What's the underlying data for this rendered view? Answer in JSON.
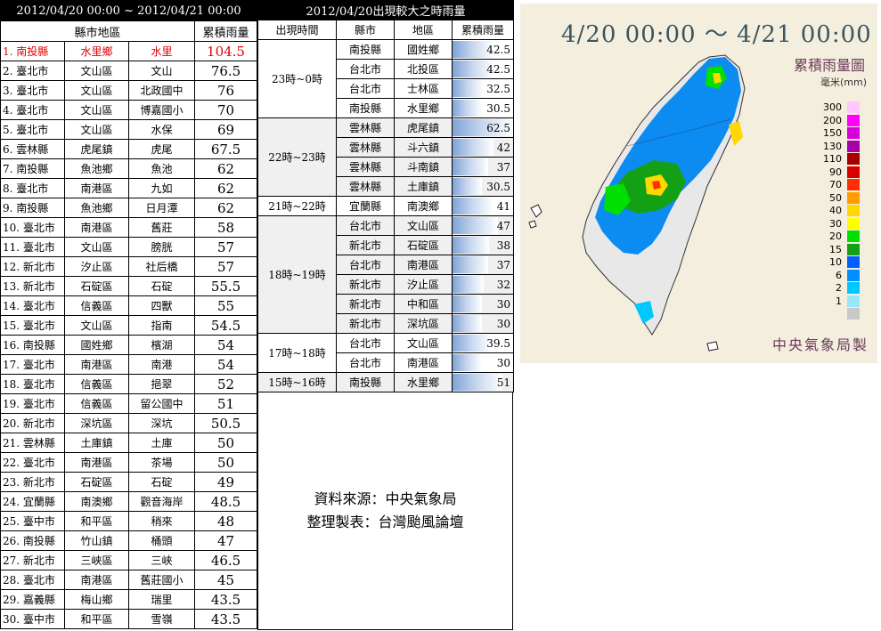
{
  "left": {
    "title": "2012/04/20 00:00 ~ 2012/04/21 00:00",
    "col_region": "縣市地區",
    "col_amount": "累積雨量",
    "rows": [
      {
        "rank": "1. 南投縣",
        "town": "水里鄉",
        "station": "水里",
        "value": "104.5"
      },
      {
        "rank": "2. 臺北市",
        "town": "文山區",
        "station": "文山",
        "value": "76.5"
      },
      {
        "rank": "3. 臺北市",
        "town": "文山區",
        "station": "北政國中",
        "value": "76"
      },
      {
        "rank": "4. 臺北市",
        "town": "文山區",
        "station": "博嘉國小",
        "value": "70"
      },
      {
        "rank": "5. 臺北市",
        "town": "文山區",
        "station": "水保",
        "value": "69"
      },
      {
        "rank": "6. 雲林縣",
        "town": "虎尾鎮",
        "station": "虎尾",
        "value": "67.5"
      },
      {
        "rank": "7. 南投縣",
        "town": "魚池鄉",
        "station": "魚池",
        "value": "62"
      },
      {
        "rank": "8. 臺北市",
        "town": "南港區",
        "station": "九如",
        "value": "62"
      },
      {
        "rank": "9. 南投縣",
        "town": "魚池鄉",
        "station": "日月潭",
        "value": "62"
      },
      {
        "rank": "10. 臺北市",
        "town": "南港區",
        "station": "舊莊",
        "value": "58"
      },
      {
        "rank": "11. 臺北市",
        "town": "文山區",
        "station": "膀胱",
        "value": "57"
      },
      {
        "rank": "12. 新北市",
        "town": "汐止區",
        "station": "社后橋",
        "value": "57"
      },
      {
        "rank": "13. 新北市",
        "town": "石碇區",
        "station": "石碇",
        "value": "55.5"
      },
      {
        "rank": "14. 臺北市",
        "town": "信義區",
        "station": "四獸",
        "value": "55"
      },
      {
        "rank": "15. 臺北市",
        "town": "文山區",
        "station": "指南",
        "value": "54.5"
      },
      {
        "rank": "16. 南投縣",
        "town": "國姓鄉",
        "station": "檳湖",
        "value": "54"
      },
      {
        "rank": "17. 臺北市",
        "town": "南港區",
        "station": "南港",
        "value": "54"
      },
      {
        "rank": "18. 臺北市",
        "town": "信義區",
        "station": "挹翠",
        "value": "52"
      },
      {
        "rank": "19. 臺北市",
        "town": "信義區",
        "station": "留公國中",
        "value": "51"
      },
      {
        "rank": "20. 新北市",
        "town": "深坑區",
        "station": "深坑",
        "value": "50.5"
      },
      {
        "rank": "21. 雲林縣",
        "town": "土庫鎮",
        "station": "土庫",
        "value": "50"
      },
      {
        "rank": "22. 臺北市",
        "town": "南港區",
        "station": "茶場",
        "value": "50"
      },
      {
        "rank": "23. 新北市",
        "town": "石碇區",
        "station": "石碇",
        "value": "49"
      },
      {
        "rank": "24. 宜蘭縣",
        "town": "南澳鄉",
        "station": "觀音海岸",
        "value": "48.5"
      },
      {
        "rank": "25. 臺中市",
        "town": "和平區",
        "station": "稍來",
        "value": "48"
      },
      {
        "rank": "26. 南投縣",
        "town": "竹山鎮",
        "station": "桶頭",
        "value": "47"
      },
      {
        "rank": "27. 新北市",
        "town": "三峽區",
        "station": "三峽",
        "value": "46.5"
      },
      {
        "rank": "28. 臺北市",
        "town": "南港區",
        "station": "舊莊國小",
        "value": "45"
      },
      {
        "rank": "29. 嘉義縣",
        "town": "梅山鄉",
        "station": "瑞里",
        "value": "43.5"
      },
      {
        "rank": "30. 臺中市",
        "town": "和平區",
        "station": "雪嶺",
        "value": "43.5"
      }
    ]
  },
  "middle": {
    "title": "2012/04/20出現較大之時雨量",
    "col_time": "出現時間",
    "col_city": "縣市",
    "col_area": "地區",
    "col_amount": "累積雨量",
    "groups": [
      {
        "time": "23時~0時",
        "rows": [
          {
            "city": "南投縣",
            "area": "國姓鄉",
            "value": "42.5",
            "v": 42.5
          },
          {
            "city": "台北市",
            "area": "北投區",
            "value": "42.5",
            "v": 42.5
          },
          {
            "city": "台北市",
            "area": "士林區",
            "value": "32.5",
            "v": 32.5
          },
          {
            "city": "南投縣",
            "area": "水里鄉",
            "value": "30.5",
            "v": 30.5
          }
        ]
      },
      {
        "time": "22時~23時",
        "rows": [
          {
            "city": "雲林縣",
            "area": "虎尾鎮",
            "value": "62.5",
            "v": 62.5
          },
          {
            "city": "雲林縣",
            "area": "斗六鎮",
            "value": "42",
            "v": 42
          },
          {
            "city": "雲林縣",
            "area": "斗南鎮",
            "value": "37",
            "v": 37
          },
          {
            "city": "雲林縣",
            "area": "土庫鎮",
            "value": "30.5",
            "v": 30.5
          }
        ]
      },
      {
        "time": "21時~22時",
        "rows": [
          {
            "city": "宜蘭縣",
            "area": "南澳鄉",
            "value": "41",
            "v": 41
          }
        ]
      },
      {
        "time": "18時~19時",
        "rows": [
          {
            "city": "台北市",
            "area": "文山區",
            "value": "47",
            "v": 47
          },
          {
            "city": "新北市",
            "area": "石碇區",
            "value": "38",
            "v": 38
          },
          {
            "city": "台北市",
            "area": "南港區",
            "value": "37",
            "v": 37
          },
          {
            "city": "新北市",
            "area": "汐止區",
            "value": "32",
            "v": 32
          },
          {
            "city": "新北市",
            "area": "中和區",
            "value": "30",
            "v": 30
          },
          {
            "city": "新北市",
            "area": "深坑區",
            "value": "30",
            "v": 30
          }
        ]
      },
      {
        "time": "17時~18時",
        "rows": [
          {
            "city": "台北市",
            "area": "文山區",
            "value": "39.5",
            "v": 39.5
          },
          {
            "city": "台北市",
            "area": "南港區",
            "value": "30",
            "v": 30
          }
        ]
      },
      {
        "time": "15時~16時",
        "rows": [
          {
            "city": "南投縣",
            "area": "水里鄉",
            "value": "51",
            "v": 51
          }
        ]
      }
    ],
    "credit_source": "資料來源：中央氣象局",
    "credit_maker": "整理製表：台灣颱風論壇"
  },
  "map": {
    "title": "4/20 00:00 ～ 4/21 00:00",
    "legend_title": "累積雨量圖",
    "unit": "毫米(mm)",
    "credit": "中央氣象局製",
    "legend": [
      {
        "label": "300",
        "color": "#ffc6ff"
      },
      {
        "label": "200",
        "color": "#ff00ff"
      },
      {
        "label": "150",
        "color": "#d800d8"
      },
      {
        "label": "130",
        "color": "#a800a8"
      },
      {
        "label": "110",
        "color": "#a80000"
      },
      {
        "label": "90",
        "color": "#d80000"
      },
      {
        "label": "70",
        "color": "#ff3000"
      },
      {
        "label": "50",
        "color": "#ff9c00"
      },
      {
        "label": "40",
        "color": "#ffd800"
      },
      {
        "label": "30",
        "color": "#ffff00"
      },
      {
        "label": "20",
        "color": "#00e000"
      },
      {
        "label": "15",
        "color": "#14a014"
      },
      {
        "label": "10",
        "color": "#0060ff"
      },
      {
        "label": "6",
        "color": "#0090ff"
      },
      {
        "label": "2",
        "color": "#00c8ff"
      },
      {
        "label": "1",
        "color": "#9be6ff"
      },
      {
        "label": "",
        "color": "#c8c8c8"
      }
    ]
  },
  "chart_data": {
    "type": "table",
    "title": "2012/04/20出現較大之時雨量",
    "series": [
      {
        "name": "累積雨量",
        "values": [
          42.5,
          42.5,
          32.5,
          30.5,
          62.5,
          42,
          37,
          30.5,
          41,
          47,
          38,
          37,
          32,
          30,
          30,
          39.5,
          30,
          51
        ]
      }
    ],
    "categories": [
      "國姓鄉",
      "北投區",
      "士林區",
      "水里鄉",
      "虎尾鎮",
      "斗六鎮",
      "斗南鎮",
      "土庫鎮",
      "南澳鄉",
      "文山區",
      "石碇區",
      "南港區",
      "汐止區",
      "中和區",
      "深坑區",
      "文山區",
      "南港區",
      "水里鄉"
    ]
  }
}
